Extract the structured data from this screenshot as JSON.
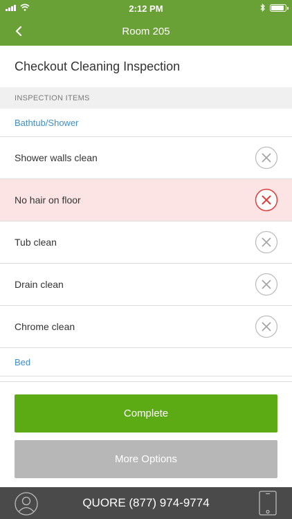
{
  "status_bar": {
    "time": "2:12 PM"
  },
  "nav": {
    "title": "Room 205"
  },
  "page": {
    "title": "Checkout Cleaning Inspection",
    "section_header": "INSPECTION ITEMS"
  },
  "groups": [
    {
      "label": "Bathtub/Shower",
      "items": [
        {
          "label": "Shower walls clean",
          "failed": false
        },
        {
          "label": "No hair on floor",
          "failed": true
        },
        {
          "label": "Tub clean",
          "failed": false
        },
        {
          "label": "Drain clean",
          "failed": false
        },
        {
          "label": "Chrome clean",
          "failed": false
        }
      ]
    },
    {
      "label": "Bed",
      "items": []
    }
  ],
  "buttons": {
    "complete": "Complete",
    "more_options": "More Options"
  },
  "footer": {
    "phone_label": "QUORE (877) 974-9774"
  },
  "colors": {
    "brand_green": "#6aa136",
    "complete_green": "#5cab15",
    "fail_red": "#e53935",
    "fail_bg": "#fde4e4",
    "link_blue": "#3d8fc9"
  },
  "icons": {
    "back": "chevron-left-icon",
    "item_action": "close-circle-icon",
    "footer_left": "user-avatar-icon",
    "footer_right": "phone-device-icon"
  }
}
